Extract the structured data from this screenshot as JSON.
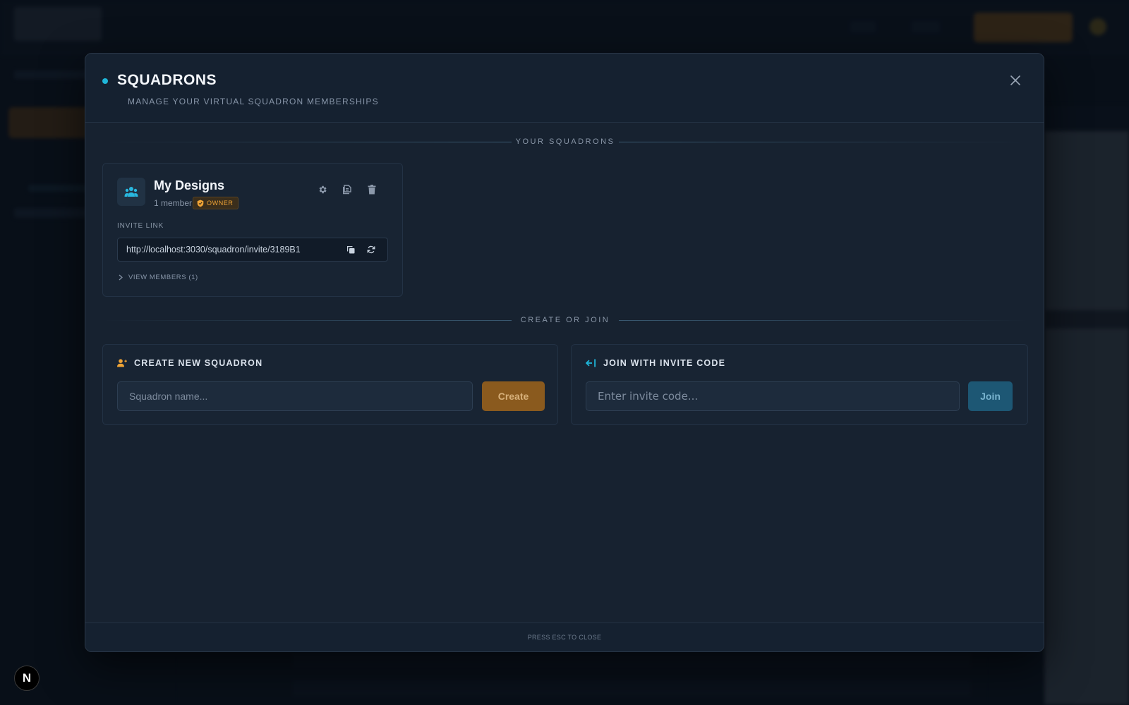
{
  "modal": {
    "title": "SQUADRONS",
    "subtitle": "MANAGE YOUR VIRTUAL SQUADRON MEMBERSHIPS",
    "close_icon": "close-icon",
    "footer": "PRESS ESC TO CLOSE"
  },
  "sections": {
    "your_squadrons": "YOUR SQUADRONS",
    "create_or_join": "CREATE OR JOIN"
  },
  "squadron": {
    "name": "My Designs",
    "members": "1 member",
    "role_badge": "OWNER",
    "avatar_icon": "group-icon",
    "actions": [
      "settings-icon",
      "duplicate-icon",
      "trash-icon"
    ],
    "invite_label": "INVITE LINK",
    "invite_url": "http://localhost:3030/squadron/invite/3189B1",
    "view_members": "VIEW MEMBERS (1)"
  },
  "create_panel": {
    "title": "CREATE NEW SQUADRON",
    "placeholder": "Squadron name...",
    "button": "Create"
  },
  "join_panel": {
    "title": "JOIN WITH INVITE CODE",
    "placeholder": "Enter invite code...",
    "button": "Join"
  },
  "colors": {
    "accent_cyan": "#1fb6d9",
    "accent_orange": "#f0a436",
    "modal_bg": "#172230",
    "page_bg": "#0c1420"
  },
  "badge": {
    "letter": "N"
  }
}
